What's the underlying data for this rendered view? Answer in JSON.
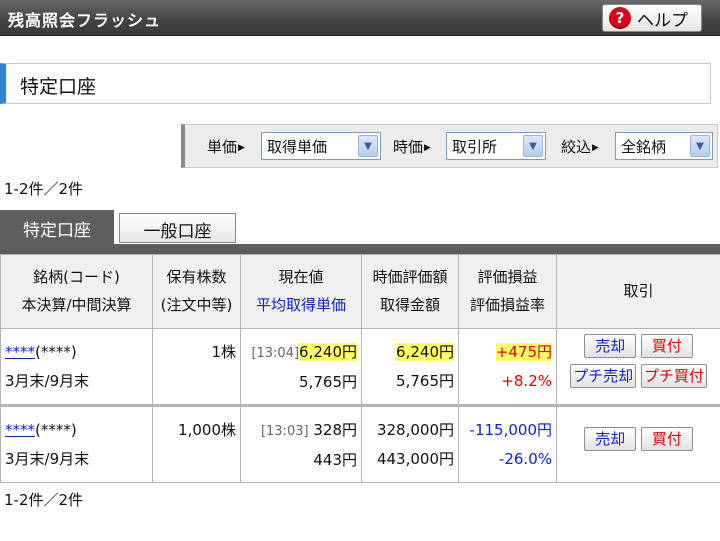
{
  "window": {
    "title": "残高照会フラッシュ"
  },
  "help": {
    "label": "ヘルプ",
    "icon": "?"
  },
  "section": {
    "title": "特定口座"
  },
  "filters": [
    {
      "label": "単価",
      "value": "取得単価"
    },
    {
      "label": "時価",
      "value": "取引所"
    },
    {
      "label": "絞込",
      "value": "全銘柄"
    }
  ],
  "count": {
    "top": "1-2件／2件",
    "bottom": "1-2件／2件"
  },
  "tabs": [
    {
      "label": "特定口座"
    },
    {
      "label": "一般口座"
    }
  ],
  "table": {
    "headers": {
      "col1_l1": "銘柄(コード)",
      "col1_l2": "本決算/中間決算",
      "col2_l1": "保有株数",
      "col2_l2": "(注文中等)",
      "col3_l1": "現在値",
      "col3_l2": "平均取得単価",
      "col4_l1": "時価評価額",
      "col4_l2": "取得金額",
      "col5_l1": "評価損益",
      "col5_l2": "評価損益率",
      "col6": "取引"
    },
    "rows": [
      {
        "name": "****",
        "code": "(****)",
        "settlement": "3月末/9月末",
        "shares": "1株",
        "time": "[13:04]",
        "price": "6,240円",
        "avg_cost": "5,765円",
        "market_value": "6,240円",
        "cost": "5,765円",
        "pl": "+475円",
        "pl_rate": "+8.2%",
        "buttons": {
          "sell": "売却",
          "buy": "買付",
          "petit_sell": "プチ売却",
          "petit_buy": "プチ買付"
        }
      },
      {
        "name": "****",
        "code": "(****)",
        "settlement": "3月末/9月末",
        "shares": "1,000株",
        "time": "[13:03]",
        "price": "328円",
        "avg_cost": "443円",
        "market_value": "328,000円",
        "cost": "443,000円",
        "pl": "-115,000円",
        "pl_rate": "-26.0%",
        "buttons": {
          "sell": "売却",
          "buy": "買付"
        }
      }
    ]
  }
}
